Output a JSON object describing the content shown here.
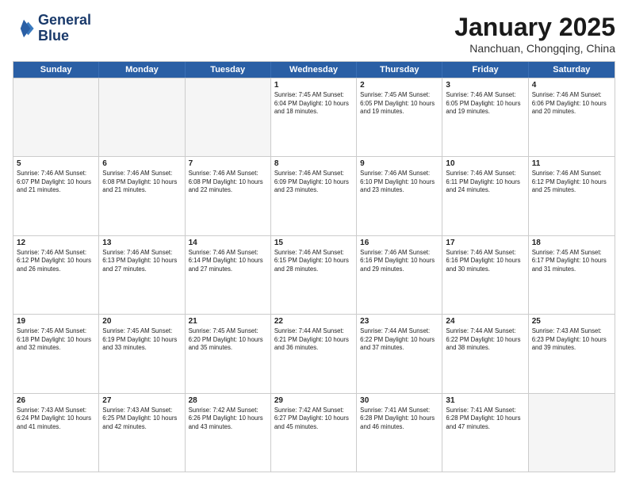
{
  "logo": {
    "line1": "General",
    "line2": "Blue"
  },
  "title": "January 2025",
  "subtitle": "Nanchuan, Chongqing, China",
  "weekdays": [
    "Sunday",
    "Monday",
    "Tuesday",
    "Wednesday",
    "Thursday",
    "Friday",
    "Saturday"
  ],
  "rows": [
    [
      {
        "day": "",
        "info": "",
        "empty": true
      },
      {
        "day": "",
        "info": "",
        "empty": true
      },
      {
        "day": "",
        "info": "",
        "empty": true
      },
      {
        "day": "1",
        "info": "Sunrise: 7:45 AM\nSunset: 6:04 PM\nDaylight: 10 hours\nand 18 minutes."
      },
      {
        "day": "2",
        "info": "Sunrise: 7:45 AM\nSunset: 6:05 PM\nDaylight: 10 hours\nand 19 minutes."
      },
      {
        "day": "3",
        "info": "Sunrise: 7:46 AM\nSunset: 6:05 PM\nDaylight: 10 hours\nand 19 minutes."
      },
      {
        "day": "4",
        "info": "Sunrise: 7:46 AM\nSunset: 6:06 PM\nDaylight: 10 hours\nand 20 minutes."
      }
    ],
    [
      {
        "day": "5",
        "info": "Sunrise: 7:46 AM\nSunset: 6:07 PM\nDaylight: 10 hours\nand 21 minutes."
      },
      {
        "day": "6",
        "info": "Sunrise: 7:46 AM\nSunset: 6:08 PM\nDaylight: 10 hours\nand 21 minutes."
      },
      {
        "day": "7",
        "info": "Sunrise: 7:46 AM\nSunset: 6:08 PM\nDaylight: 10 hours\nand 22 minutes."
      },
      {
        "day": "8",
        "info": "Sunrise: 7:46 AM\nSunset: 6:09 PM\nDaylight: 10 hours\nand 23 minutes."
      },
      {
        "day": "9",
        "info": "Sunrise: 7:46 AM\nSunset: 6:10 PM\nDaylight: 10 hours\nand 23 minutes."
      },
      {
        "day": "10",
        "info": "Sunrise: 7:46 AM\nSunset: 6:11 PM\nDaylight: 10 hours\nand 24 minutes."
      },
      {
        "day": "11",
        "info": "Sunrise: 7:46 AM\nSunset: 6:12 PM\nDaylight: 10 hours\nand 25 minutes."
      }
    ],
    [
      {
        "day": "12",
        "info": "Sunrise: 7:46 AM\nSunset: 6:12 PM\nDaylight: 10 hours\nand 26 minutes."
      },
      {
        "day": "13",
        "info": "Sunrise: 7:46 AM\nSunset: 6:13 PM\nDaylight: 10 hours\nand 27 minutes."
      },
      {
        "day": "14",
        "info": "Sunrise: 7:46 AM\nSunset: 6:14 PM\nDaylight: 10 hours\nand 27 minutes."
      },
      {
        "day": "15",
        "info": "Sunrise: 7:46 AM\nSunset: 6:15 PM\nDaylight: 10 hours\nand 28 minutes."
      },
      {
        "day": "16",
        "info": "Sunrise: 7:46 AM\nSunset: 6:16 PM\nDaylight: 10 hours\nand 29 minutes."
      },
      {
        "day": "17",
        "info": "Sunrise: 7:46 AM\nSunset: 6:16 PM\nDaylight: 10 hours\nand 30 minutes."
      },
      {
        "day": "18",
        "info": "Sunrise: 7:45 AM\nSunset: 6:17 PM\nDaylight: 10 hours\nand 31 minutes."
      }
    ],
    [
      {
        "day": "19",
        "info": "Sunrise: 7:45 AM\nSunset: 6:18 PM\nDaylight: 10 hours\nand 32 minutes."
      },
      {
        "day": "20",
        "info": "Sunrise: 7:45 AM\nSunset: 6:19 PM\nDaylight: 10 hours\nand 33 minutes."
      },
      {
        "day": "21",
        "info": "Sunrise: 7:45 AM\nSunset: 6:20 PM\nDaylight: 10 hours\nand 35 minutes."
      },
      {
        "day": "22",
        "info": "Sunrise: 7:44 AM\nSunset: 6:21 PM\nDaylight: 10 hours\nand 36 minutes."
      },
      {
        "day": "23",
        "info": "Sunrise: 7:44 AM\nSunset: 6:22 PM\nDaylight: 10 hours\nand 37 minutes."
      },
      {
        "day": "24",
        "info": "Sunrise: 7:44 AM\nSunset: 6:22 PM\nDaylight: 10 hours\nand 38 minutes."
      },
      {
        "day": "25",
        "info": "Sunrise: 7:43 AM\nSunset: 6:23 PM\nDaylight: 10 hours\nand 39 minutes."
      }
    ],
    [
      {
        "day": "26",
        "info": "Sunrise: 7:43 AM\nSunset: 6:24 PM\nDaylight: 10 hours\nand 41 minutes."
      },
      {
        "day": "27",
        "info": "Sunrise: 7:43 AM\nSunset: 6:25 PM\nDaylight: 10 hours\nand 42 minutes."
      },
      {
        "day": "28",
        "info": "Sunrise: 7:42 AM\nSunset: 6:26 PM\nDaylight: 10 hours\nand 43 minutes."
      },
      {
        "day": "29",
        "info": "Sunrise: 7:42 AM\nSunset: 6:27 PM\nDaylight: 10 hours\nand 45 minutes."
      },
      {
        "day": "30",
        "info": "Sunrise: 7:41 AM\nSunset: 6:28 PM\nDaylight: 10 hours\nand 46 minutes."
      },
      {
        "day": "31",
        "info": "Sunrise: 7:41 AM\nSunset: 6:28 PM\nDaylight: 10 hours\nand 47 minutes."
      },
      {
        "day": "",
        "info": "",
        "empty": true
      }
    ]
  ]
}
